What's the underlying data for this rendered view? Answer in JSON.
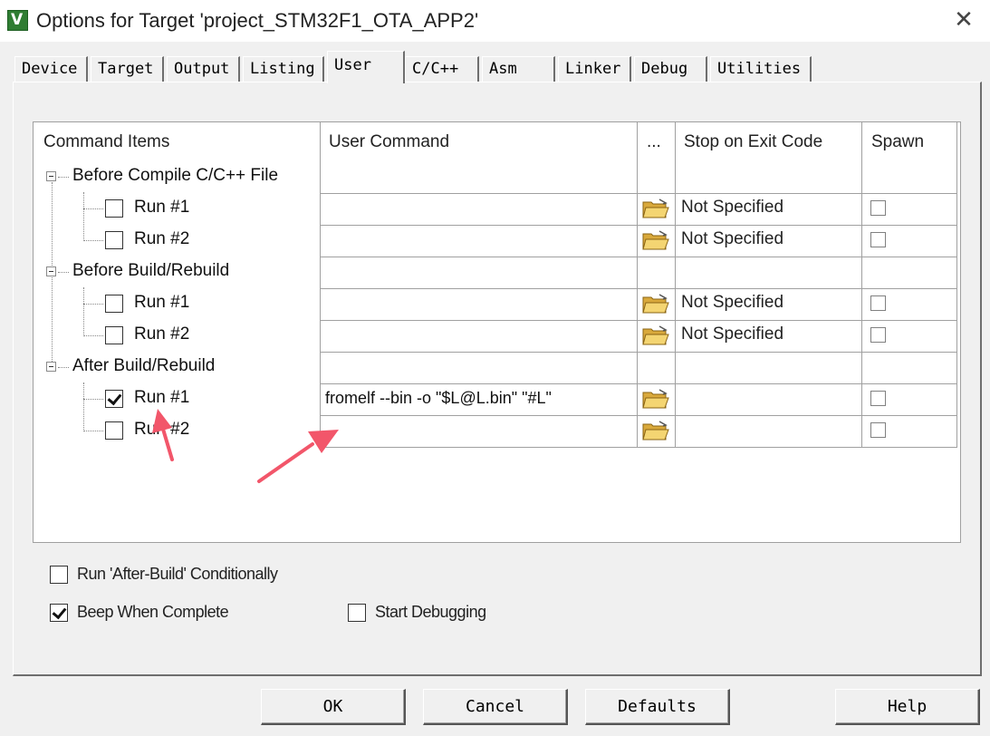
{
  "window": {
    "icon_glyph": "V",
    "title": "Options for Target 'project_STM32F1_OTA_APP2'",
    "close_glyph": "✕"
  },
  "tabs": [
    {
      "label": "Device",
      "active": false
    },
    {
      "label": "Target",
      "active": false
    },
    {
      "label": "Output",
      "active": false
    },
    {
      "label": "Listing",
      "active": false
    },
    {
      "label": "User",
      "active": true
    },
    {
      "label": "C/C++",
      "active": false
    },
    {
      "label": "Asm",
      "active": false
    },
    {
      "label": "Linker",
      "active": false
    },
    {
      "label": "Debug",
      "active": false
    },
    {
      "label": "Utilities",
      "active": false
    }
  ],
  "grid": {
    "headers": {
      "command_items": "Command Items",
      "user_command": "User Command",
      "browse": "...",
      "stop_on_exit": "Stop on Exit Code",
      "spawn": "Spawn"
    },
    "groups": [
      {
        "label": "Before Compile C/C++ File",
        "runs": [
          {
            "label": "Run #1",
            "checked": false,
            "command": "",
            "stop_on_exit": "Not Specified",
            "spawn": false
          },
          {
            "label": "Run #2",
            "checked": false,
            "command": "",
            "stop_on_exit": "Not Specified",
            "spawn": false
          }
        ]
      },
      {
        "label": "Before Build/Rebuild",
        "runs": [
          {
            "label": "Run #1",
            "checked": false,
            "command": "",
            "stop_on_exit": "Not Specified",
            "spawn": false
          },
          {
            "label": "Run #2",
            "checked": false,
            "command": "",
            "stop_on_exit": "Not Specified",
            "spawn": false
          }
        ]
      },
      {
        "label": "After Build/Rebuild",
        "runs": [
          {
            "label": "Run #1",
            "checked": true,
            "command": "fromelf --bin -o \"$L@L.bin\" \"#L\"",
            "stop_on_exit": "",
            "spawn": false
          },
          {
            "label": "Run #2",
            "checked": false,
            "command": "",
            "stop_on_exit": "",
            "spawn": false
          }
        ]
      }
    ]
  },
  "options": {
    "run_after_build": {
      "label": "Run 'After-Build' Conditionally",
      "checked": false
    },
    "beep_when_complete": {
      "label": "Beep When Complete",
      "checked": true
    },
    "start_debugging": {
      "label": "Start Debugging",
      "checked": false
    }
  },
  "buttons": {
    "ok": "OK",
    "cancel": "Cancel",
    "defaults": "Defaults",
    "help": "Help"
  },
  "colors": {
    "annotation_arrow": "#f2566a",
    "app_icon": "#2f7d32",
    "dialog_bg": "#f0f0f0"
  }
}
